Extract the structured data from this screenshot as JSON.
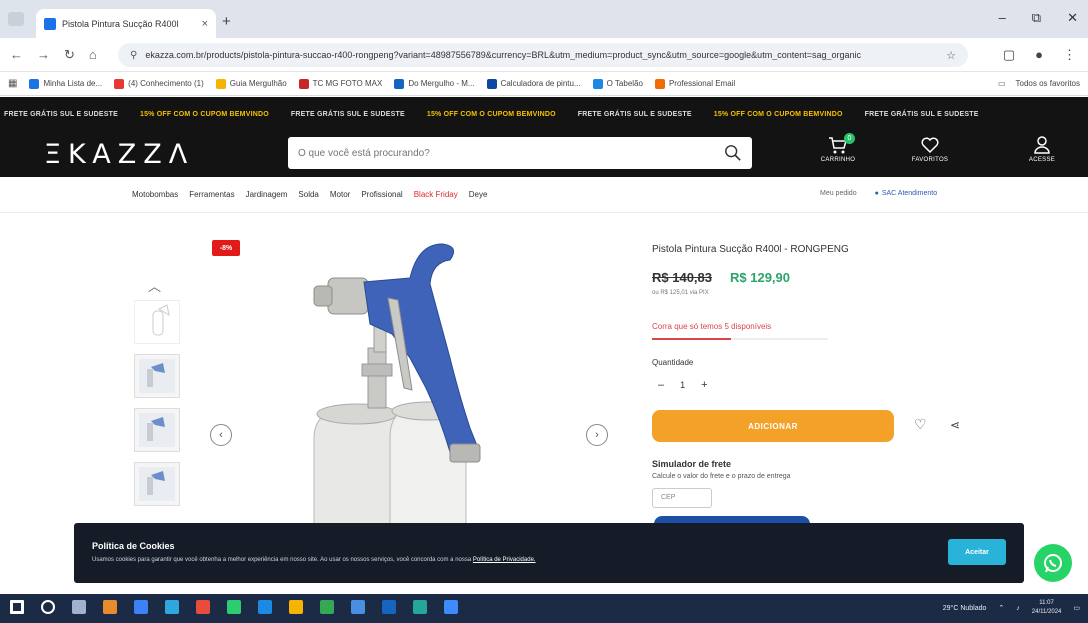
{
  "browser": {
    "tab_title": "Pistola Pintura Sucção R400l",
    "tab_close": "×",
    "new_tab": "+",
    "window_controls": [
      "–",
      "⧉",
      "✕"
    ],
    "url": "ekazza.com.br/products/pistola-pintura-succao-r400-rongpeng?variant=48987556789&currency=BRL&utm_medium=product_sync&utm_source=google&utm_content=sag_organic",
    "bookmarks": [
      {
        "label": "Minha Lista de...",
        "color": "#1a73e8"
      },
      {
        "label": "(4) Conhecimento (1)",
        "color": "#e53935"
      },
      {
        "label": "Guia Mergulhão",
        "color": "#f4b400"
      },
      {
        "label": "TC MG FOTO MAX",
        "color": "#c62828"
      },
      {
        "label": "Do Mergulho - M...",
        "color": "#1565c0"
      },
      {
        "label": "Calculadora de pintu...",
        "color": "#0d47a1"
      },
      {
        "label": "O Tabelão",
        "color": "#1e88e5"
      },
      {
        "label": "Professional Email",
        "color": "#ef6c00"
      }
    ],
    "bookmarks_right": "Todos os favoritos"
  },
  "site": {
    "promo_items": [
      {
        "text": "FRETE GRÁTIS SUL E SUDESTE",
        "highlight": false
      },
      {
        "text": "15% OFF COM O CUPOM BEMVINDO",
        "highlight": true
      },
      {
        "text": "FRETE GRÁTIS SUL E SUDESTE",
        "highlight": false
      },
      {
        "text": "15% OFF COM O CUPOM BEMVINDO",
        "highlight": true
      },
      {
        "text": "FRETE GRÁTIS SUL E SUDESTE",
        "highlight": false
      },
      {
        "text": "15% OFF COM O CUPOM BEMVINDO",
        "highlight": true
      },
      {
        "text": "FRETE GRÁTIS SUL E SUDESTE",
        "highlight": false
      }
    ],
    "logo": "ΞKAZZΛ",
    "search_placeholder": "O que você está procurando?",
    "header_icons": {
      "cart_label": "CARRINHO",
      "cart_count": "0",
      "favorites_label": "FAVORITOS",
      "account_label": "ACESSE"
    },
    "categories": [
      {
        "label": "Motobombas",
        "red": false
      },
      {
        "label": "Ferramentas",
        "red": false
      },
      {
        "label": "Jardinagem",
        "red": false
      },
      {
        "label": "Solda",
        "red": false
      },
      {
        "label": "Motor",
        "red": false
      },
      {
        "label": "Profissional",
        "red": false
      },
      {
        "label": "Black Friday",
        "red": true
      },
      {
        "label": "Deye",
        "red": false
      }
    ],
    "nav_right": {
      "track": "Meu pedido",
      "service": "SAC Atendimento"
    }
  },
  "product": {
    "discount_badge": "-8%",
    "title": "Pistola Pintura Sucção R400l - RONGPENG",
    "old_price": "R$ 140,83",
    "new_price": "R$ 129,90",
    "installment": "ou R$ 125,01 via PIX",
    "stock_note": "Corra que só temos 5 disponíveis",
    "stock_fraction": 0.45,
    "quantity_label": "Quantidade",
    "quantity": "1",
    "qty_minus": "–",
    "qty_plus": "+",
    "buy_label": "ADICIONAR",
    "shipping_title": "Simulador de frete",
    "shipping_desc": "Calcule o valor do frete e o prazo de entrega",
    "cep_placeholder": "CEP"
  },
  "cookie": {
    "title": "Política de Cookies",
    "desc": "Usamos cookies para garantir que você obtenha a melhor experiência em nosso site. Ao usar os nossos serviços, você concorda com a nossa",
    "link": "Política de Privacidade.",
    "accept": "Aceitar"
  },
  "taskbar": {
    "weather": "29°C Nublado",
    "time": "11:07",
    "date": "24/11/2024"
  },
  "colors": {
    "accent_orange": "#f3a128",
    "price_green": "#2ba36c",
    "header_bg": "#131313",
    "cookie_bg": "#161c27"
  }
}
